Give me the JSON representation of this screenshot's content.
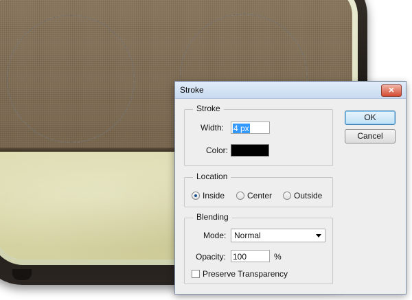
{
  "dialog": {
    "title": "Stroke",
    "close_label": "✕",
    "ok_label": "OK",
    "cancel_label": "Cancel",
    "stroke_group": {
      "label": "Stroke",
      "width_label": "Width:",
      "width_value": "4 px",
      "color_label": "Color:",
      "color_value": "#000000"
    },
    "location_group": {
      "label": "Location",
      "options": [
        "Inside",
        "Center",
        "Outside"
      ],
      "selected": "Inside"
    },
    "blending_group": {
      "label": "Blending",
      "mode_label": "Mode:",
      "mode_value": "Normal",
      "opacity_label": "Opacity:",
      "opacity_value": "100",
      "opacity_unit": "%",
      "preserve_label": "Preserve Transparency",
      "preserve_checked": false
    }
  },
  "canvas": {
    "selection": "elliptical marquee selections (2)"
  },
  "colors": {
    "title_bar": "#c9daf0",
    "dialog_bg": "#eeeeee",
    "close_button": "#d34a2f",
    "highlight": "#3399ff"
  }
}
